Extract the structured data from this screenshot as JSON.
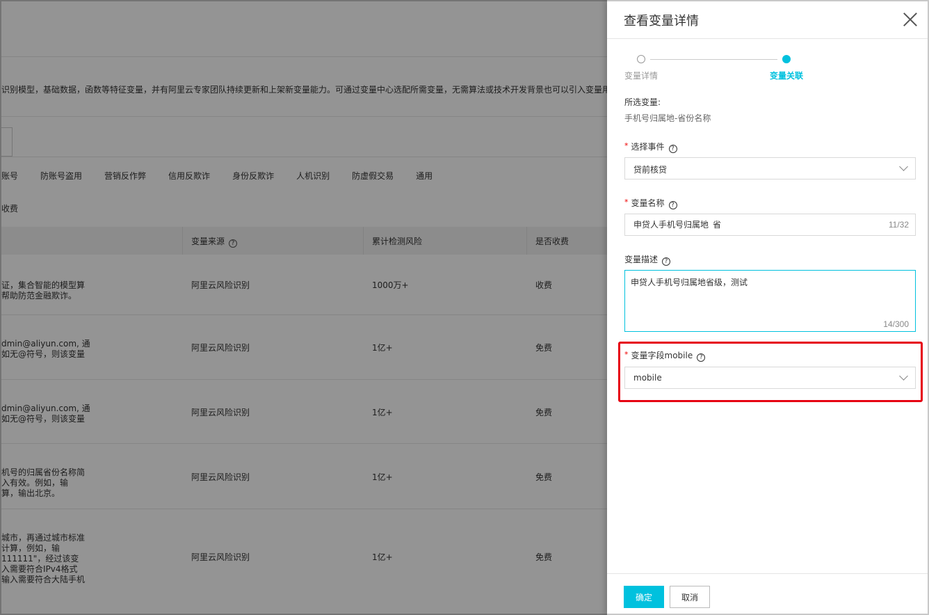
{
  "background": {
    "description": "识别模型，基础数据，函数等特征变量，并有阿里云专家团队持续更新和上架新变量能力。可通过变量中心选配所需变量，无需算法或技术开发背景也可以引入变量用",
    "tabs": [
      "账号",
      "防账号盗用",
      "营销反作弊",
      "信用反欺诈",
      "身份反欺诈",
      "人机识别",
      "防虚假交易",
      "通用"
    ],
    "fee_filter": "收费",
    "table": {
      "headers": [
        "变量来源",
        "累计检测风险",
        "是否收费"
      ],
      "rows": [
        {
          "desc": "证，集合智能的模型算\n帮助防范金融欺诈。",
          "source": "阿里云风险识别",
          "risk": "1000万+",
          "fee": "收费"
        },
        {
          "desc": "dmin@aliyun.com, 通\n如无@符号，则该变量",
          "source": "阿里云风险识别",
          "risk": "1亿+",
          "fee": "免费"
        },
        {
          "desc": "dmin@aliyun.com, 通\n如无@符号，则该变量",
          "source": "阿里云风险识别",
          "risk": "1亿+",
          "fee": "免费"
        },
        {
          "desc": "机号的归属省份名称简\n入有效。例如，输\n算，输出北京。",
          "source": "阿里云风险识别",
          "risk": "1亿+",
          "fee": "免费"
        },
        {
          "desc": "城市，再通过城市标准\n计算，例如，输\n111111\"，经过该变\n入需要符合IPv4格式\n输入需要符合大陆手机",
          "source": "阿里云风险识别",
          "risk": "1亿+",
          "fee": "免费"
        }
      ]
    }
  },
  "drawer": {
    "title": "查看变量详情",
    "steps": [
      {
        "label": "变量详情",
        "state": "done"
      },
      {
        "label": "变量关联",
        "state": "active"
      }
    ],
    "selected_label": "所选变量:",
    "selected_value": "手机号归属地-省份名称",
    "event_field": {
      "label": "选择事件",
      "value": "贷前核贷",
      "required": true
    },
    "name_field": {
      "label": "变量名称",
      "value": "申贷人手机号归属地_省",
      "counter": "11/32",
      "required": true
    },
    "desc_field": {
      "label": "变量描述",
      "value": "申贷人手机号归属地省级，测试",
      "counter": "14/300"
    },
    "mobile_field": {
      "label": "变量字段mobile",
      "value": "mobile",
      "required": true
    },
    "help_glyph": "?",
    "ok_label": "确定",
    "cancel_label": "取消"
  },
  "colors": {
    "accent": "#00c1de",
    "highlight": "#e60012",
    "required": "#ee0000"
  }
}
